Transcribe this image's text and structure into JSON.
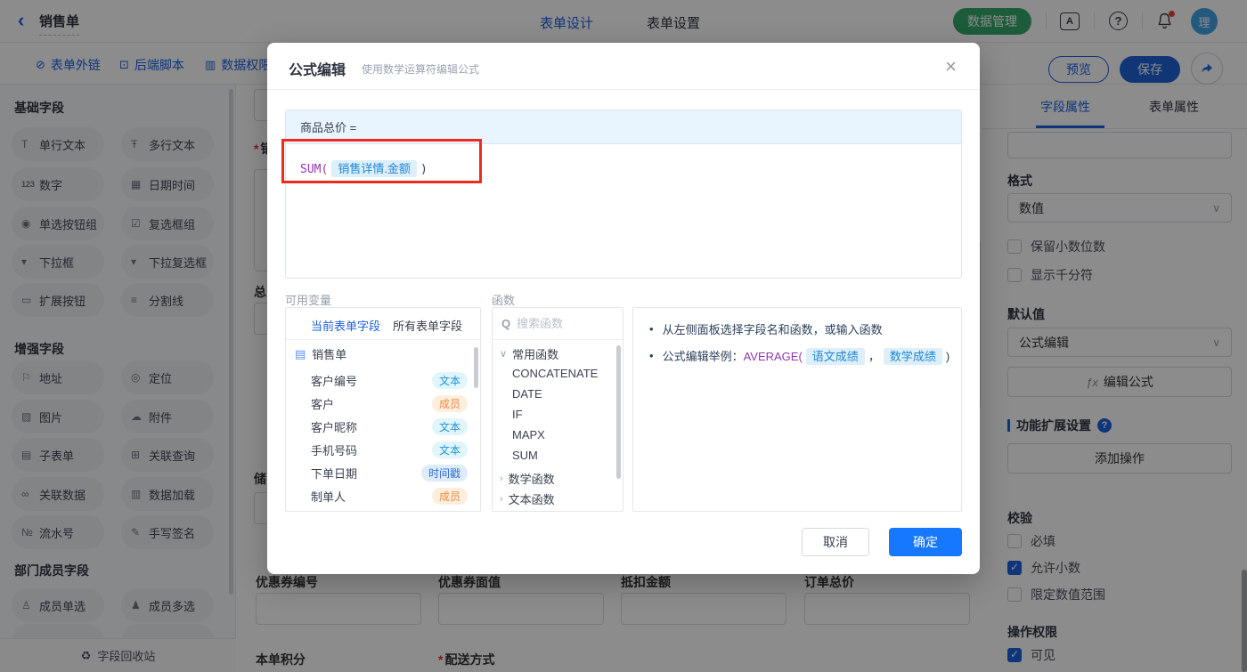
{
  "colors": {
    "accent_blue": "#1c62e0",
    "confirm_blue": "#1677ff",
    "green": "#34a86a",
    "red_annotation": "#ee2b1f",
    "badge_text_blue": "#1e93d6",
    "badge_member_orange": "#ef8b45",
    "badge_time_blue": "#2e6fd3",
    "formula_func_purple": "#9335b5",
    "chip_blue": "#1f87d4"
  },
  "icons": {
    "back": "‹",
    "translate": "A",
    "help": "?",
    "close": "×",
    "search": "Q",
    "chevron_down": "∨",
    "chevron_right": "›",
    "doc": "▤",
    "bullet": "•",
    "fx": "ƒx",
    "link": "⊘",
    "script": "⊡",
    "perm": "▥",
    "single_text": "T",
    "multi_text": "Ŧ",
    "number": "123",
    "datetime": "▦",
    "radio": "◉",
    "checkbox": "☑",
    "dropdown": "▾",
    "multi_dropdown": "▾",
    "expand_btn": "▭",
    "divider": "≡",
    "address": "⚐",
    "locate": "◎",
    "image": "▨",
    "attachment": "☁",
    "subform": "▤",
    "lookup": "⊞",
    "link_data": "∞",
    "data_load": "▥",
    "serial": "№",
    "signature": "✎",
    "member_single": "♙",
    "member_multi": "♟",
    "recycle": "♻"
  },
  "topbar": {
    "title": "销售单",
    "tabs": [
      {
        "label": "表单设计"
      },
      {
        "label": "表单设置"
      }
    ],
    "data_manage_label": "数据管理",
    "avatar_text": "理"
  },
  "toolbar": {
    "links": [
      {
        "label": "表单外链"
      },
      {
        "label": "后端脚本"
      },
      {
        "label": "数据权限"
      }
    ],
    "preview_label": "预览",
    "save_label": "保存"
  },
  "sidebar": {
    "sections": [
      {
        "title": "基础字段",
        "items": [
          {
            "label": "单行文本"
          },
          {
            "label": "多行文本"
          },
          {
            "label": "数字"
          },
          {
            "label": "日期时间"
          },
          {
            "label": "单选按钮组"
          },
          {
            "label": "复选框组"
          },
          {
            "label": "下拉框"
          },
          {
            "label": "下拉复选框"
          },
          {
            "label": "扩展按钮"
          },
          {
            "label": "分割线"
          }
        ]
      },
      {
        "title": "增强字段",
        "items": [
          {
            "label": "地址"
          },
          {
            "label": "定位"
          },
          {
            "label": "图片"
          },
          {
            "label": "附件"
          },
          {
            "label": "子表单"
          },
          {
            "label": "关联查询"
          },
          {
            "label": "关联数据"
          },
          {
            "label": "数据加载"
          },
          {
            "label": "流水号"
          },
          {
            "label": "手写签名"
          }
        ]
      },
      {
        "title": "部门成员字段",
        "items": [
          {
            "label": "成员单选"
          },
          {
            "label": "成员多选"
          }
        ]
      }
    ],
    "recycle_label": "字段回收站"
  },
  "canvas": {
    "required_mark": "*",
    "partial_label_sales": "销",
    "partial_label_total": "总",
    "partial_label_store": "储",
    "coupon_fields": [
      {
        "label": "优惠券编号"
      },
      {
        "label": "优惠券面值"
      },
      {
        "label": "抵扣金额"
      },
      {
        "label": "订单总价"
      }
    ],
    "points_label": "本单积分",
    "delivery_label": "配送方式"
  },
  "modal": {
    "title": "公式编辑",
    "subtitle": "使用数学运算符编辑公式",
    "formula_target": "商品总价 =",
    "formula_func": "SUM(",
    "formula_chip": "销售详情.金额",
    "formula_close": ")",
    "variables": {
      "label": "可用变量",
      "tabs": [
        {
          "label": "当前表单字段"
        },
        {
          "label": "所有表单字段"
        }
      ],
      "root": "销售单",
      "fields": [
        {
          "name": "客户编号",
          "type": "文本"
        },
        {
          "name": "客户",
          "type": "成员"
        },
        {
          "name": "客户昵称",
          "type": "文本"
        },
        {
          "name": "手机号码",
          "type": "文本"
        },
        {
          "name": "下单日期",
          "type": "时间戳"
        },
        {
          "name": "制单人",
          "type": "成员"
        }
      ]
    },
    "functions": {
      "label": "函数",
      "search_placeholder": "搜索函数",
      "common_group": "常用函数",
      "common_items": [
        {
          "name": "CONCATENATE"
        },
        {
          "name": "DATE"
        },
        {
          "name": "IF"
        },
        {
          "name": "MAPX"
        },
        {
          "name": "SUM"
        }
      ],
      "math_group": "数学函数",
      "text_group": "文本函数"
    },
    "help": {
      "tip1": "从左侧面板选择字段名和函数，或输入函数",
      "tip2_prefix": "公式编辑举例：",
      "tip2_func": "AVERAGE(",
      "tip2_chip1": "语文成绩",
      "tip2_comma": "，",
      "tip2_chip2": "数学成绩",
      "tip2_close": ")"
    },
    "cancel_label": "取消",
    "confirm_label": "确定"
  },
  "right_panel": {
    "tabs": [
      {
        "label": "字段属性"
      },
      {
        "label": "表单属性"
      }
    ],
    "format_label": "格式",
    "format_value": "数值",
    "format_checks": [
      {
        "label": "保留小数位数",
        "checked": false
      },
      {
        "label": "显示千分符",
        "checked": false
      }
    ],
    "default_label": "默认值",
    "default_value": "公式编辑",
    "edit_formula_label": "编辑公式",
    "ext_label": "功能扩展设置",
    "add_action_label": "添加操作",
    "validate_label": "校验",
    "validate_checks": [
      {
        "label": "必填",
        "checked": false
      },
      {
        "label": "允许小数",
        "checked": true
      },
      {
        "label": "限定数值范围",
        "checked": false
      }
    ],
    "perm_label": "操作权限",
    "perm_checks": [
      {
        "label": "可见",
        "checked": true
      }
    ]
  }
}
